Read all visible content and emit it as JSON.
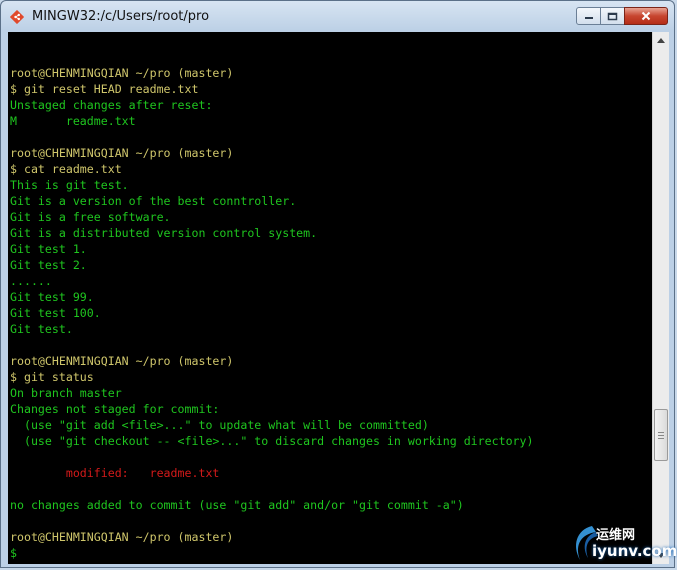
{
  "window": {
    "title": "MINGW32:/c/Users/root/pro"
  },
  "colors": {
    "prompt": "#cfc66b",
    "output": "#1fc61f",
    "modified": "#d31a1a",
    "background": "#000000"
  },
  "terminal": {
    "lines": [
      {
        "type": "blank",
        "text": ""
      },
      {
        "type": "prompt",
        "text": "root@CHENMINGQIAN ~/pro (master)"
      },
      {
        "type": "prompt",
        "text": "$ git reset HEAD readme.txt"
      },
      {
        "type": "out",
        "text": "Unstaged changes after reset:"
      },
      {
        "type": "out",
        "text": "M       readme.txt"
      },
      {
        "type": "blank",
        "text": ""
      },
      {
        "type": "prompt",
        "text": "root@CHENMINGQIAN ~/pro (master)"
      },
      {
        "type": "prompt",
        "text": "$ cat readme.txt"
      },
      {
        "type": "out",
        "text": "This is git test."
      },
      {
        "type": "out",
        "text": "Git is a version of the best conntroller."
      },
      {
        "type": "out",
        "text": "Git is a free software."
      },
      {
        "type": "out",
        "text": "Git is a distributed version control system."
      },
      {
        "type": "out",
        "text": "Git test 1."
      },
      {
        "type": "out",
        "text": "Git test 2."
      },
      {
        "type": "out",
        "text": "......"
      },
      {
        "type": "out",
        "text": "Git test 99."
      },
      {
        "type": "out",
        "text": "Git test 100."
      },
      {
        "type": "out",
        "text": "Git test."
      },
      {
        "type": "blank",
        "text": ""
      },
      {
        "type": "prompt",
        "text": "root@CHENMINGQIAN ~/pro (master)"
      },
      {
        "type": "prompt",
        "text": "$ git status"
      },
      {
        "type": "out",
        "text": "On branch master"
      },
      {
        "type": "out",
        "text": "Changes not staged for commit:"
      },
      {
        "type": "out",
        "text": "  (use \"git add <file>...\" to update what will be committed)"
      },
      {
        "type": "out",
        "text": "  (use \"git checkout -- <file>...\" to discard changes in working directory)"
      },
      {
        "type": "blank",
        "text": ""
      },
      {
        "type": "mod",
        "text": "        modified:   readme.txt"
      },
      {
        "type": "blank",
        "text": ""
      },
      {
        "type": "out",
        "text": "no changes added to commit (use \"git add\" and/or \"git commit -a\")"
      },
      {
        "type": "blank",
        "text": ""
      },
      {
        "type": "prompt",
        "text": "root@CHENMINGQIAN ~/pro (master)"
      },
      {
        "type": "out",
        "text": "$"
      }
    ]
  },
  "watermark": {
    "name": "运维网",
    "url": "iyunv.com"
  },
  "icons": {
    "app": "git-diamond-icon",
    "minimize": "minimize-icon",
    "maximize": "maximize-icon",
    "close": "close-icon",
    "scroll_up": "scroll-up-arrow-icon",
    "scroll_down": "scroll-down-arrow-icon"
  }
}
